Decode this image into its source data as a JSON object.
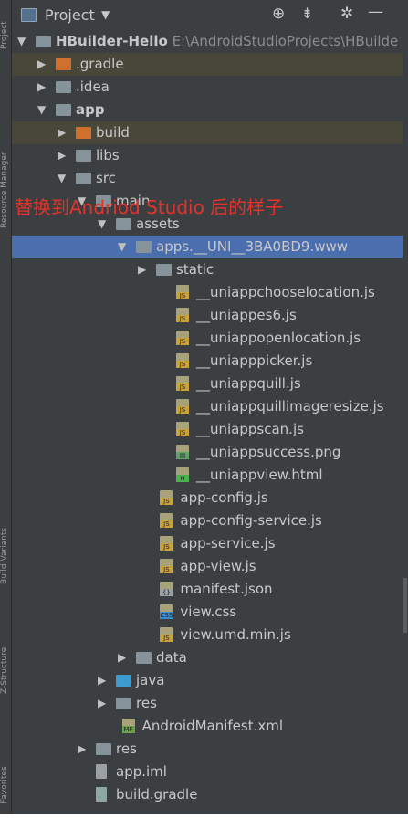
{
  "header": {
    "title": "Project",
    "dropdown_icon": "chevron-down-icon",
    "toolbar_icons": [
      "target-icon",
      "collapse-icon",
      "gear-icon",
      "minimize-icon"
    ]
  },
  "side_tabs": [
    "Project",
    "Resource Manager",
    "Build Variants",
    "Z-Structure",
    "Favorites"
  ],
  "overlay_text": "替换到Andriod Studio 后的样子",
  "tree": [
    {
      "label": "HBuilder-Hello",
      "path": "E:\\AndroidStudioProjects\\HBuilde",
      "depth": 0,
      "expanded": true,
      "kind": "project",
      "bold": true
    },
    {
      "label": ".gradle",
      "depth": 1,
      "expanded": false,
      "kind": "folder-orange"
    },
    {
      "label": ".idea",
      "depth": 1,
      "expanded": false,
      "kind": "folder"
    },
    {
      "label": "app",
      "depth": 1,
      "expanded": true,
      "kind": "module",
      "bold": true
    },
    {
      "label": "build",
      "depth": 2,
      "expanded": false,
      "kind": "folder-orange"
    },
    {
      "label": "libs",
      "depth": 2,
      "expanded": false,
      "kind": "folder"
    },
    {
      "label": "src",
      "depth": 2,
      "expanded": true,
      "kind": "folder"
    },
    {
      "label": "main",
      "depth": 3,
      "expanded": true,
      "kind": "folder"
    },
    {
      "label": "assets",
      "depth": 4,
      "expanded": true,
      "kind": "folder"
    },
    {
      "label": "apps.__UNI__3BA0BD9.www",
      "depth": 5,
      "expanded": true,
      "kind": "folder",
      "selected": true
    },
    {
      "label": "static",
      "depth": 6,
      "expanded": false,
      "kind": "folder"
    },
    {
      "label": "__uniappchooselocation.js",
      "depth": 7,
      "kind": "js"
    },
    {
      "label": "__uniappes6.js",
      "depth": 7,
      "kind": "js"
    },
    {
      "label": "__uniappopenlocation.js",
      "depth": 7,
      "kind": "js"
    },
    {
      "label": "__uniapppicker.js",
      "depth": 7,
      "kind": "js"
    },
    {
      "label": "__uniappquill.js",
      "depth": 7,
      "kind": "js"
    },
    {
      "label": "__uniappquillimageresize.js",
      "depth": 7,
      "kind": "js"
    },
    {
      "label": "__uniappscan.js",
      "depth": 7,
      "kind": "js"
    },
    {
      "label": "__uniappsuccess.png",
      "depth": 7,
      "kind": "png"
    },
    {
      "label": "__uniappview.html",
      "depth": 7,
      "kind": "html"
    },
    {
      "label": "app-config.js",
      "depth": 6.2,
      "kind": "js"
    },
    {
      "label": "app-config-service.js",
      "depth": 6.2,
      "kind": "js"
    },
    {
      "label": "app-service.js",
      "depth": 6.2,
      "kind": "js"
    },
    {
      "label": "app-view.js",
      "depth": 6.2,
      "kind": "js"
    },
    {
      "label": "manifest.json",
      "depth": 6.2,
      "kind": "json"
    },
    {
      "label": "view.css",
      "depth": 6.2,
      "kind": "css"
    },
    {
      "label": "view.umd.min.js",
      "depth": 6.2,
      "kind": "js"
    },
    {
      "label": "data",
      "depth": 5,
      "expanded": false,
      "kind": "folder"
    },
    {
      "label": "java",
      "depth": 4,
      "expanded": false,
      "kind": "folder-blue"
    },
    {
      "label": "res",
      "depth": 4,
      "expanded": false,
      "kind": "folder-res"
    },
    {
      "label": "AndroidManifest.xml",
      "depth": 4.3,
      "kind": "mf"
    },
    {
      "label": "res",
      "depth": 3,
      "expanded": false,
      "kind": "folder"
    },
    {
      "label": "app.iml",
      "depth": 3,
      "kind": "file"
    },
    {
      "label": "build.gradle",
      "depth": 3,
      "kind": "gradle"
    }
  ],
  "highlight_rows": [
    1,
    4
  ],
  "colors": {
    "background": "#3c3f41",
    "selection": "#4b6eaf",
    "highlight": "#49463a",
    "overlay": "#e3332b"
  }
}
